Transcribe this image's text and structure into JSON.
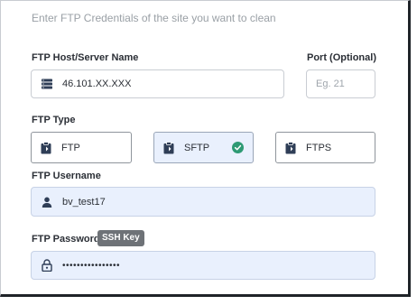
{
  "intro_text": "Enter FTP Credentials of the site you want to clean",
  "host": {
    "label": "FTP Host/Server Name",
    "value": "46.101.XX.XXX",
    "icon": "server-icon"
  },
  "port": {
    "label": "Port (Optional)",
    "placeholder": "Eg. 21"
  },
  "ftp_type": {
    "label": "FTP Type",
    "options": [
      "FTP",
      "SFTP",
      "FTPS"
    ],
    "selected": "SFTP"
  },
  "username": {
    "label": "FTP Username",
    "value": "bv_test17",
    "icon": "user-icon"
  },
  "password": {
    "label": "FTP Password",
    "badge": "SSH Key",
    "value": "••••••••••••••••",
    "icon": "lock-icon"
  },
  "colors": {
    "filled_bg": "#e9f0fd",
    "check_green": "#2e9a74",
    "icon_dark": "#2f3e57"
  }
}
